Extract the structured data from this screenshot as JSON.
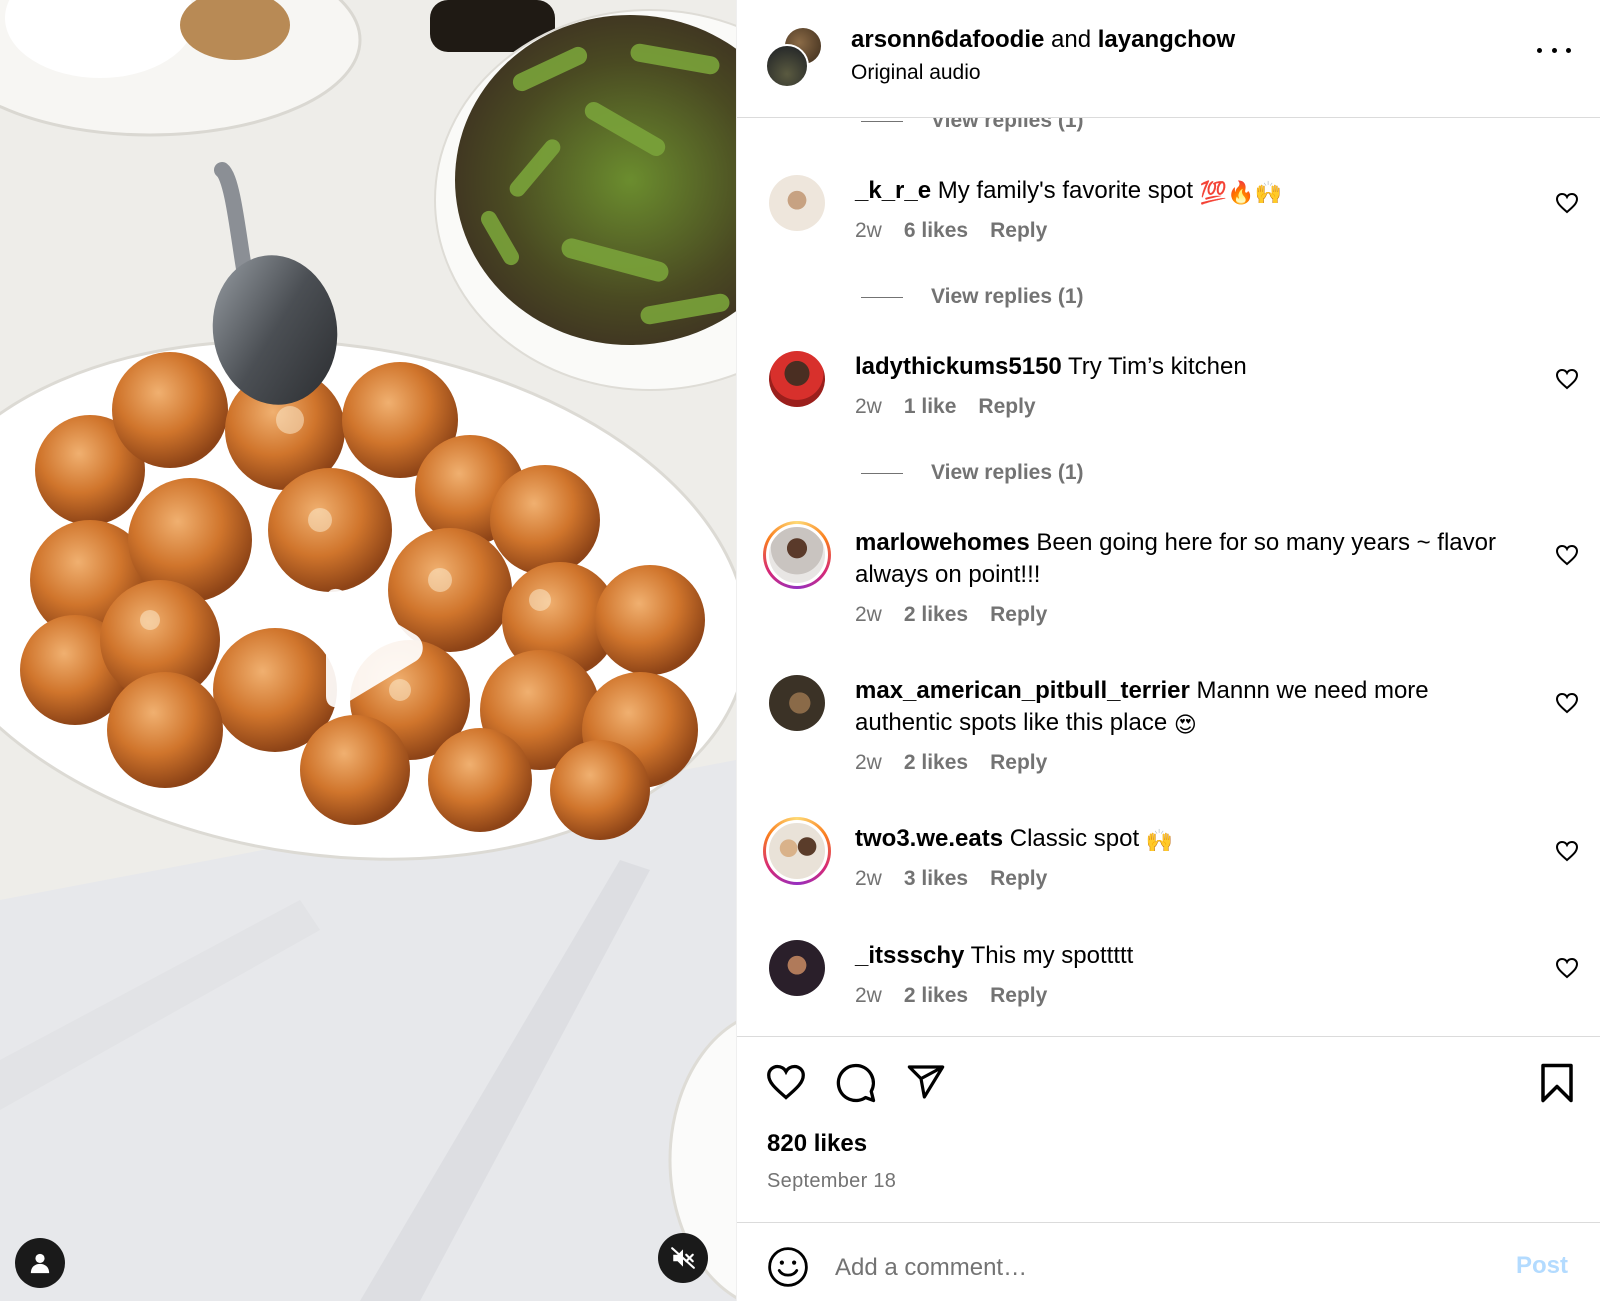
{
  "header": {
    "user1": "arsonn6dafoodie",
    "joiner": "and",
    "user2": "layangchow",
    "subtitle": "Original audio",
    "more_icon": "more-horizontal-icon"
  },
  "partial_view_replies": "View replies (1)",
  "comments": [
    {
      "username": "_k_r_e",
      "text": "My family's favorite spot",
      "emoji": "💯🔥🙌",
      "time": "2w",
      "likes": "6 likes",
      "reply": "Reply",
      "view_replies": "View replies (1)"
    },
    {
      "username": "ladythickums5150",
      "text": "Try Tim’s kitchen",
      "emoji": "",
      "time": "2w",
      "likes": "1 like",
      "reply": "Reply",
      "view_replies": "View replies (1)"
    },
    {
      "username": "marlowehomes",
      "text": "Been going here for so many years ~ flavor always on point!!!",
      "emoji": "",
      "time": "2w",
      "likes": "2 likes",
      "reply": "Reply"
    },
    {
      "username": "max_american_pitbull_terrier",
      "text": "Mannn we need more authentic spots like this place",
      "emoji": "😍",
      "time": "2w",
      "likes": "2 likes",
      "reply": "Reply"
    },
    {
      "username": "two3.we.eats",
      "text": "Classic spot",
      "emoji": "🙌",
      "time": "2w",
      "likes": "3 likes",
      "reply": "Reply"
    },
    {
      "username": "_itssschy",
      "text": "This my spottttt",
      "emoji": "",
      "time": "2w",
      "likes": "2 likes",
      "reply": "Reply"
    }
  ],
  "post": {
    "likes": "820 likes",
    "date": "September 18"
  },
  "composer": {
    "placeholder": "Add a comment…",
    "post_label": "Post"
  },
  "colors": {
    "muted_text": "#737373",
    "post_button_disabled": "#b3dbff",
    "divider": "#dbdbdb"
  }
}
